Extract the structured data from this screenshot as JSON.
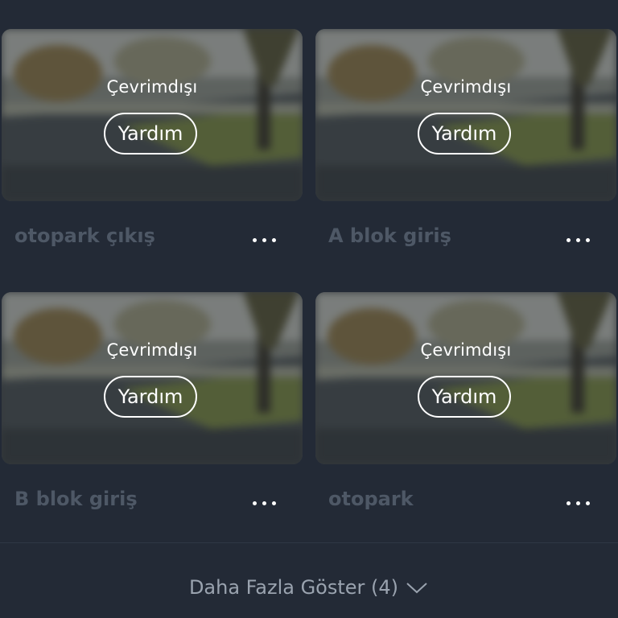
{
  "cameras": [
    {
      "name": "otopark çıkış",
      "status": "Çevrimdışı",
      "help_label": "Yardım"
    },
    {
      "name": "A blok giriş",
      "status": "Çevrimdışı",
      "help_label": "Yardım"
    },
    {
      "name": "B blok giriş",
      "status": "Çevrimdışı",
      "help_label": "Yardım"
    },
    {
      "name": "otopark",
      "status": "Çevrimdışı",
      "help_label": "Yardım"
    }
  ],
  "footer": {
    "show_more_label": "Daha Fazla Göster (4)"
  },
  "icons": {
    "more": "more-options-icon",
    "expand": "chevron-down-icon"
  },
  "colors": {
    "background": "#232a36",
    "card_name": "#4e5866",
    "show_more_text": "#9aa3af"
  }
}
